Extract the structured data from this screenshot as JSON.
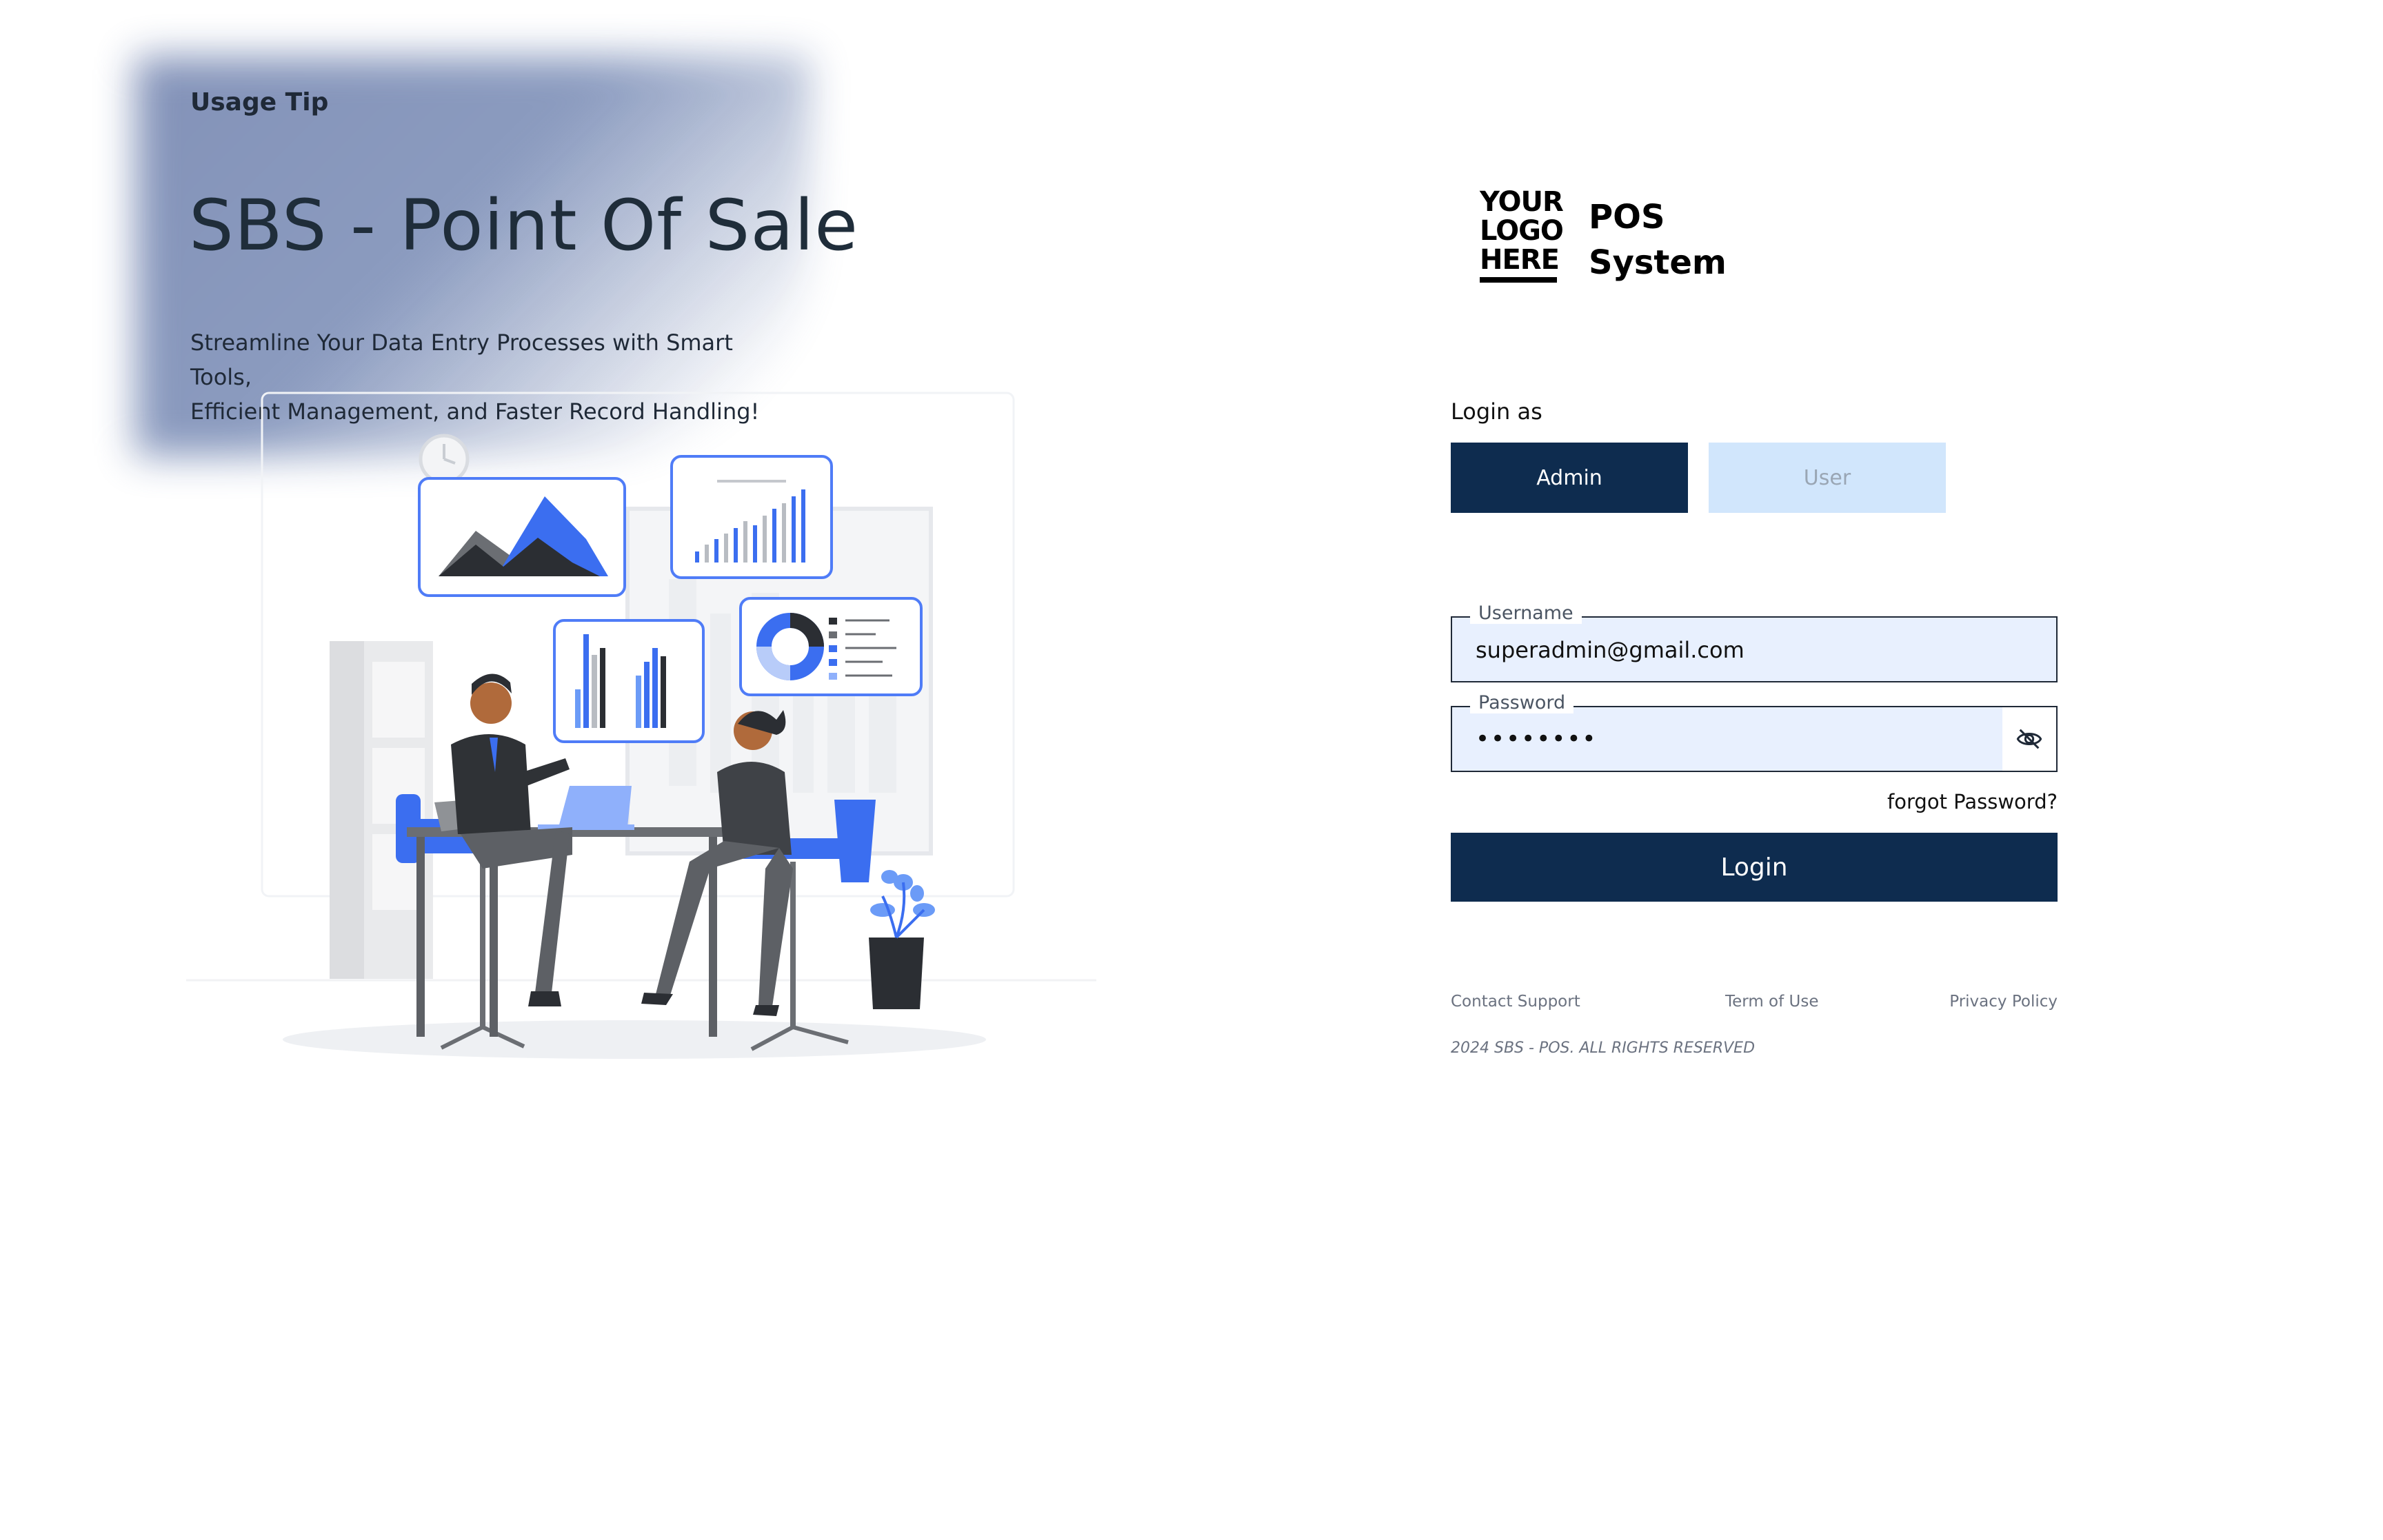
{
  "hero": {
    "tip_label": "Usage Tip",
    "title": "SBS - Point Of Sale",
    "subtitle_line1": "Streamline Your Data Entry Processes with Smart Tools,",
    "subtitle_line2": "Efficient Management, and Faster Record Handling!",
    "illustration_icon": "business-meeting-illustration"
  },
  "brand": {
    "logo_line1": "YOUR",
    "logo_line2": "LOGO",
    "logo_line3": "HERE",
    "name_line1": "POS",
    "name_line2": "System"
  },
  "login": {
    "login_as_label": "Login as",
    "roles": [
      {
        "label": "Admin",
        "selected": true
      },
      {
        "label": "User",
        "selected": false
      }
    ],
    "username_label": "Username",
    "username_value": "superadmin@gmail.com",
    "password_label": "Password",
    "password_masked": "••••••••",
    "toggle_icon": "eye-slash-icon",
    "forgot_label": "forgot Password?",
    "submit_label": "Login"
  },
  "footer": {
    "links": [
      "Contact Support",
      "Term of Use",
      "Privacy Policy"
    ],
    "copyright": "2024 SBS - POS. ALL RIGHTS RESERVED"
  },
  "colors": {
    "primary": "#0e2c4f",
    "user_button_bg": "#d1e6fc",
    "input_bg": "#e8f0fe",
    "accent_blue": "#3b6ef0"
  }
}
